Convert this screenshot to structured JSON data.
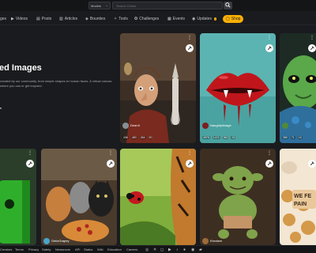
{
  "search": {
    "model_label": "Models",
    "placeholder": "Search Civitai"
  },
  "nav": [
    {
      "icon": "images-icon",
      "glyph": "▣",
      "label": "ges"
    },
    {
      "icon": "video-icon",
      "glyph": "▶",
      "label": "Videos"
    },
    {
      "icon": "posts-icon",
      "glyph": "▤",
      "label": "Posts"
    },
    {
      "icon": "articles-icon",
      "glyph": "▥",
      "label": "Articles"
    },
    {
      "icon": "bounties-icon",
      "glyph": "◈",
      "label": "Bounties"
    },
    {
      "icon": "tools-icon",
      "glyph": "✧",
      "label": "Tools"
    },
    {
      "icon": "challenges-icon",
      "glyph": "✪",
      "label": "Challenges"
    },
    {
      "icon": "events-icon",
      "glyph": "▦",
      "label": "Events"
    },
    {
      "icon": "updates-icon",
      "glyph": "◉",
      "label": "Updates"
    },
    {
      "icon": "shop-icon",
      "glyph": "▢",
      "label": "Shop"
    }
  ],
  "hero": {
    "title": "ed Images",
    "description": "created by our community, from simple shapes er human faces. A virtual canvas where you can er get inspired.",
    "more": "e"
  },
  "cards": [
    {
      "user": "Dean3",
      "stats": [
        "436",
        "483",
        "264",
        "90"
      ]
    },
    {
      "user": "Naughtylimage",
      "stats": [
        "4976",
        "1474",
        "362",
        "24"
      ]
    },
    {
      "user": "",
      "stats": [
        "380",
        "71",
        "16",
        ""
      ]
    },
    {
      "user": "",
      "stats": []
    },
    {
      "user": "GelloGrapey",
      "stats": []
    },
    {
      "user": "",
      "stats": []
    },
    {
      "user": "Khrolam",
      "stats": []
    },
    {
      "user": "",
      "stats": []
    }
  ],
  "footer": {
    "links": [
      "Creators",
      "Terms",
      "Privacy",
      "Safety",
      "Newsroom",
      "API",
      "Status",
      "Wiki",
      "Education",
      "Careers"
    ],
    "icons": [
      "discord-icon",
      "x-icon",
      "instagram-icon",
      "youtube-icon",
      "tiktok-icon",
      "reddit-icon",
      "github-icon",
      "twitch-icon"
    ]
  }
}
